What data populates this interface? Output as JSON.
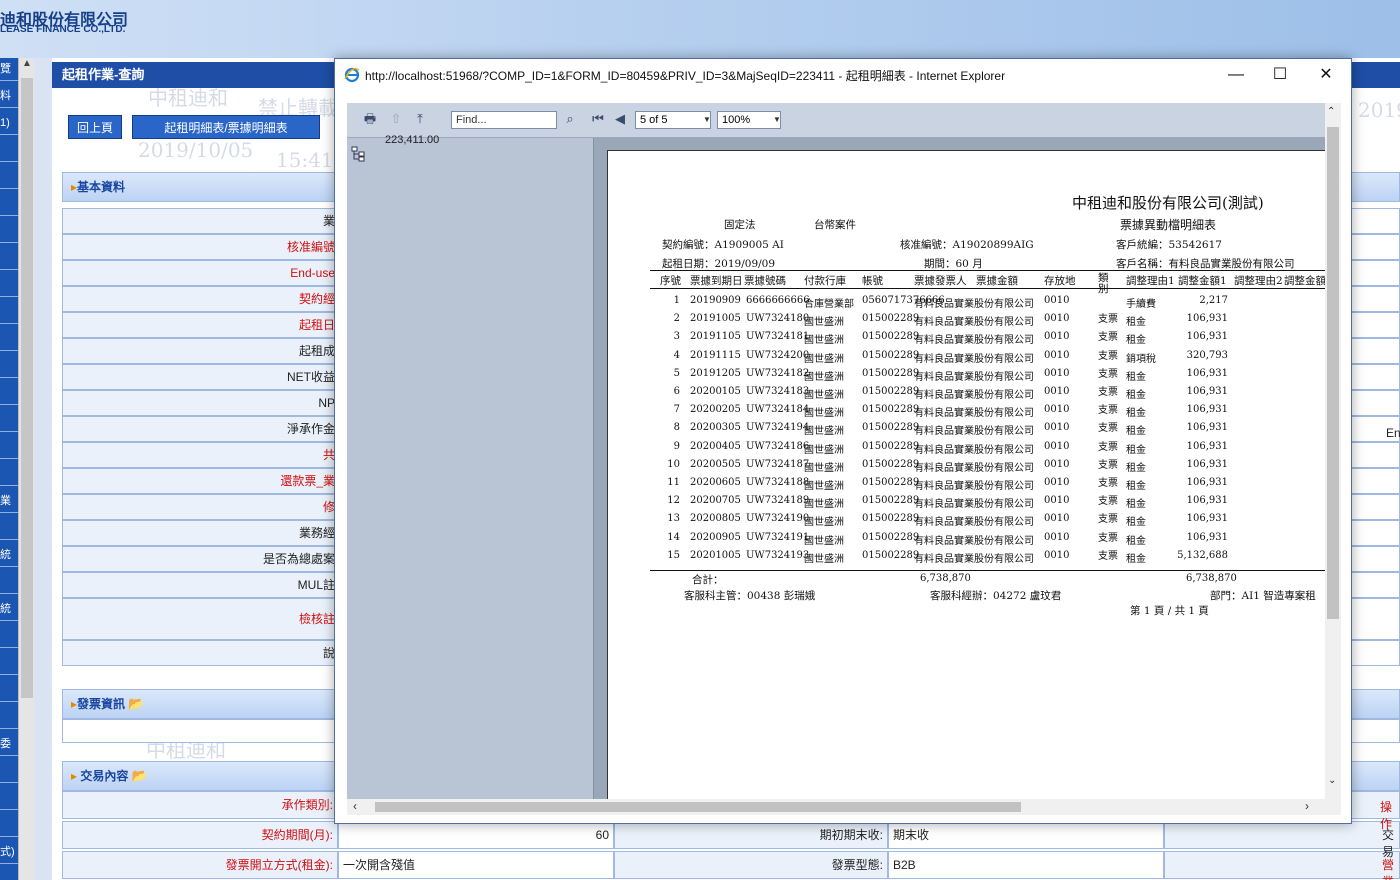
{
  "banner": {
    "company_zh": "迪和股份有限公司",
    "company_en": "LEASE FINANCE CO.,LTD."
  },
  "left_nav": [
    "覽",
    "料",
    "1)",
    "",
    "",
    "",
    "",
    "",
    "",
    "",
    "",
    "",
    "",
    "",
    "",
    "",
    "業",
    "",
    "統",
    "",
    "統",
    "",
    "",
    "",
    "",
    "委",
    "",
    "",
    "",
    "式)"
  ],
  "app": {
    "page_title": "起租作業-查詢",
    "buttons": {
      "back": "回上頁",
      "detail": "起租明細表/票據明細表"
    },
    "watermark": [
      "中租迪和",
      "禁止轉載",
      "2019/10/05",
      "15:41",
      "中租迪和",
      "2019/10/05"
    ],
    "section_basic": "基本資料",
    "section_invoice": "發票資訊",
    "section_trade": "交易內容",
    "rows": [
      {
        "label": "業",
        "color": "blk"
      },
      {
        "label": "核准編號",
        "color": "red"
      },
      {
        "label": "End-use",
        "color": "red"
      },
      {
        "label": "契約經",
        "color": "red"
      },
      {
        "label": "起租日",
        "color": "red"
      },
      {
        "label": "起租成",
        "color": "blk"
      },
      {
        "label": "NET收益",
        "color": "blk"
      },
      {
        "label": "NP",
        "color": "blk"
      },
      {
        "label": "淨承作金",
        "color": "blk"
      },
      {
        "label": "共",
        "color": "red"
      },
      {
        "label": "還款票_業",
        "color": "red"
      },
      {
        "label": "修",
        "color": "red"
      },
      {
        "label": "業務經",
        "color": "blk"
      },
      {
        "label": "是否為總處案",
        "color": "blk"
      },
      {
        "label": "MUL註",
        "color": "blk"
      },
      {
        "label": "檢核註",
        "color": "red"
      },
      {
        "label": "說",
        "color": "blk"
      }
    ],
    "right_edge": {
      "en": "En",
      "op": "操作",
      "tx": "交易",
      "tax": "營業"
    },
    "trade_rows": [
      {
        "label1": "承作類別:",
        "value1": "",
        "label2": "",
        "value2": ""
      },
      {
        "label1": "契約期間(月):",
        "value1": "60",
        "label2": "期初期末收:",
        "value2": "期末收"
      },
      {
        "label1": "發票開立方式(租金):",
        "value1": "一次開含殘值",
        "label2": "發票型態:",
        "value2": "B2B"
      }
    ]
  },
  "popup": {
    "title": "http://localhost:51968/?COMP_ID=1&FORM_ID=80459&PRIV_ID=3&MajSeqID=223411 - 起租明細表 - Internet Explorer",
    "controls": {
      "minimize": "—",
      "maximize": "☐",
      "close": "✕"
    },
    "toolbar": {
      "find_placeholder": "Find...",
      "page": "5 of 5",
      "zoom": "100%"
    },
    "doc_map_value": "223,411.00"
  },
  "report": {
    "company": "中租迪和股份有限公司(測試)",
    "title": "票據異動檔明細表",
    "method": "固定法",
    "case_type": "台幣案件",
    "contract_no_label": "契約編號：",
    "contract_no": "A1909005 AI",
    "approve_no_label": "核准編號：",
    "approve_no": "A19020899AIG",
    "cust_id_label": "客戶統編：",
    "cust_id": "53542617",
    "start_label": "起租日期：",
    "start_date": "2019/09/09",
    "period_label": "期間：",
    "period": "60 月",
    "cust_name_label": "客戶名稱：",
    "cust_name": "有料良品實業股份有限公司",
    "columns": [
      "序號",
      "票據到期日",
      "票據號碼",
      "付款行庫",
      "帳號",
      "票據發票人",
      "票據金額",
      "存放地",
      "類別",
      "調整理由1",
      "調整金額1",
      "調整理由2",
      "調整金額2"
    ],
    "rows": [
      [
        "1",
        "20190909",
        "6666666666",
        "合庫營業部",
        "0560717376666",
        "有料良品實業股份有限公司",
        "",
        "0010",
        "",
        "手續費",
        "2,217"
      ],
      [
        "2",
        "20191005",
        "UW7324180",
        "國世盛洲",
        "015002289",
        "有料良品實業股份有限公司",
        "",
        "0010",
        "支票",
        "租金",
        "106,931"
      ],
      [
        "3",
        "20191105",
        "UW7324181",
        "國世盛洲",
        "015002289",
        "有料良品實業股份有限公司",
        "",
        "0010",
        "支票",
        "租金",
        "106,931"
      ],
      [
        "4",
        "20191115",
        "UW7324200",
        "國世盛洲",
        "015002289",
        "有料良品實業股份有限公司",
        "",
        "0010",
        "支票",
        "銷項稅",
        "320,793"
      ],
      [
        "5",
        "20191205",
        "UW7324182",
        "國世盛洲",
        "015002289",
        "有料良品實業股份有限公司",
        "",
        "0010",
        "支票",
        "租金",
        "106,931"
      ],
      [
        "6",
        "20200105",
        "UW7324183",
        "國世盛洲",
        "015002289",
        "有料良品實業股份有限公司",
        "",
        "0010",
        "支票",
        "租金",
        "106,931"
      ],
      [
        "7",
        "20200205",
        "UW7324184",
        "國世盛洲",
        "015002289",
        "有料良品實業股份有限公司",
        "",
        "0010",
        "支票",
        "租金",
        "106,931"
      ],
      [
        "8",
        "20200305",
        "UW7324194",
        "國世盛洲",
        "015002289",
        "有料良品實業股份有限公司",
        "",
        "0010",
        "支票",
        "租金",
        "106,931"
      ],
      [
        "9",
        "20200405",
        "UW7324186",
        "國世盛洲",
        "015002289",
        "有料良品實業股份有限公司",
        "",
        "0010",
        "支票",
        "租金",
        "106,931"
      ],
      [
        "10",
        "20200505",
        "UW7324187",
        "國世盛洲",
        "015002289",
        "有料良品實業股份有限公司",
        "",
        "0010",
        "支票",
        "租金",
        "106,931"
      ],
      [
        "11",
        "20200605",
        "UW7324188",
        "國世盛洲",
        "015002289",
        "有料良品實業股份有限公司",
        "",
        "0010",
        "支票",
        "租金",
        "106,931"
      ],
      [
        "12",
        "20200705",
        "UW7324189",
        "國世盛洲",
        "015002289",
        "有料良品實業股份有限公司",
        "",
        "0010",
        "支票",
        "租金",
        "106,931"
      ],
      [
        "13",
        "20200805",
        "UW7324190",
        "國世盛洲",
        "015002289",
        "有料良品實業股份有限公司",
        "",
        "0010",
        "支票",
        "租金",
        "106,931"
      ],
      [
        "14",
        "20200905",
        "UW7324191",
        "國世盛洲",
        "015002289",
        "有料良品實業股份有限公司",
        "",
        "0010",
        "支票",
        "租金",
        "106,931"
      ],
      [
        "15",
        "20201005",
        "UW7324193",
        "國世盛洲",
        "015002289",
        "有料良品實業股份有限公司",
        "",
        "0010",
        "支票",
        "租金",
        "5,132,688"
      ]
    ],
    "total_label": "合計：",
    "total_amount": "6,738,870",
    "total_adjust": "6,738,870",
    "footer_left": "客服科主管：00438 彭瑞娥",
    "footer_mid": "客服科經辦：04272 盧玟君",
    "footer_right": "部門：AI1 智造專案租",
    "page_info": "第 1 頁 / 共 1 頁"
  }
}
